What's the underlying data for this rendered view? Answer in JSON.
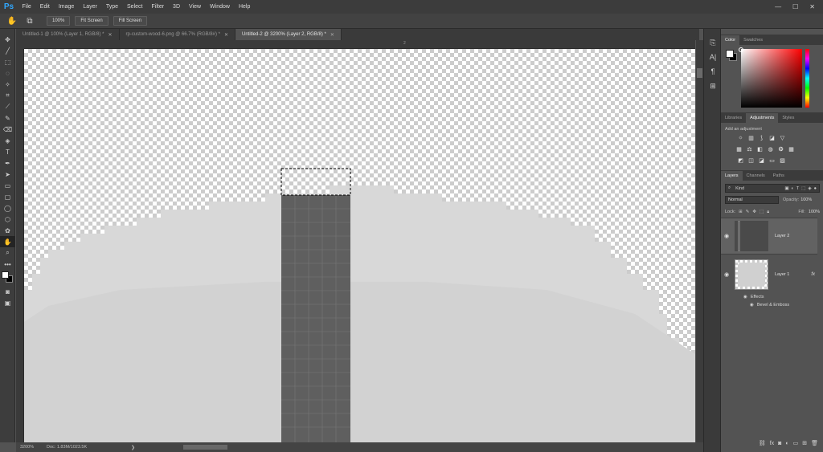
{
  "app": {
    "logo": "Ps"
  },
  "menu": [
    "File",
    "Edit",
    "Image",
    "Layer",
    "Type",
    "Select",
    "Filter",
    "3D",
    "View",
    "Window",
    "Help"
  ],
  "window_controls": {
    "minimize": "—",
    "maximize": "☐",
    "close": "✕"
  },
  "options_bar": {
    "hand_icon": "hand-icon",
    "zoom_100": "100%",
    "fit_screen": "Fit Screen",
    "fill_screen": "Fill Screen"
  },
  "tabs": [
    {
      "label": "Untitled-1 @ 100% (Layer 1, RGB/8) *",
      "active": false
    },
    {
      "label": "rp-custom-wood-6.png @ 66.7% (RGB/8#) *",
      "active": false
    },
    {
      "label": "Untitled-2 @ 3200% (Layer 2, RGB/8) *",
      "active": true
    }
  ],
  "ruler": {
    "top_label": "2"
  },
  "status": {
    "zoom": "3200%",
    "doc": "Doc: 1.83M/1023.5K",
    "arrow": "❯"
  },
  "panels": {
    "color_tabs": [
      "Color",
      "Swatches"
    ],
    "adj_tabs": [
      "Libraries",
      "Adjustments",
      "Styles"
    ],
    "adj_title": "Add an adjustment",
    "layers_tabs": [
      "Layers",
      "Channels",
      "Paths"
    ],
    "filter_kind": "Kind",
    "blend_mode": "Normal",
    "opacity_label": "Opacity:",
    "opacity_value": "100%",
    "lock_label": "Lock:",
    "fill_label": "Fill:",
    "fill_value": "100%"
  },
  "layers": [
    {
      "name": "Layer 2",
      "selected": true
    },
    {
      "name": "Layer 1",
      "selected": false,
      "fx": "fx"
    }
  ],
  "effects": {
    "effects_label": "Effects",
    "bevel_label": "Bevel & Emboss"
  },
  "colors": {
    "accent": "#31a8ff",
    "canvas_light": "#d9d9d9",
    "dark_column": "#5f5f5f"
  }
}
